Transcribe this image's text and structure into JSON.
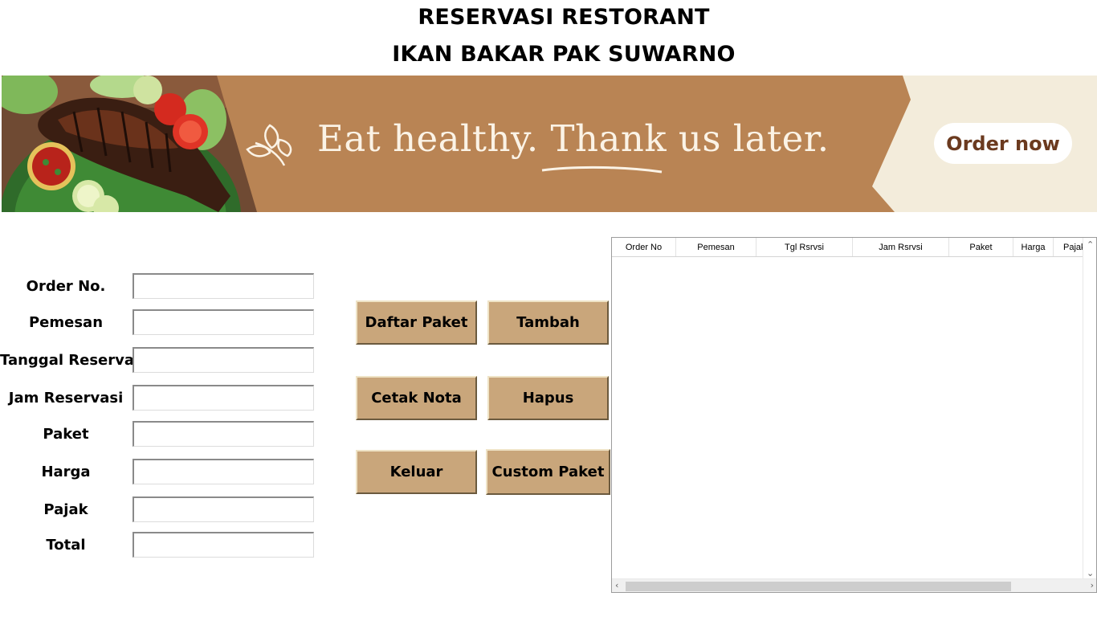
{
  "header": {
    "title_line1": "RESERVASI RESTORANT",
    "title_line2": "IKAN BAKAR PAK SUWARNO"
  },
  "banner": {
    "slogan": "Eat healthy. Thank us later.",
    "order_button": "Order now",
    "colors": {
      "ribbon": "#b98454",
      "cream": "#f3ecdb",
      "button_text": "#6b3a1f"
    },
    "icons": [
      "grilled-fish-icon",
      "leaf-sprig-icon"
    ]
  },
  "form": {
    "fields": [
      {
        "label": "Order No.",
        "value": ""
      },
      {
        "label": "Pemesan",
        "value": ""
      },
      {
        "label": "Tanggal Reservasi",
        "value": ""
      },
      {
        "label": "Jam Reservasi",
        "value": ""
      },
      {
        "label": "Paket",
        "value": ""
      },
      {
        "label": "Harga",
        "value": ""
      },
      {
        "label": "Pajak",
        "value": ""
      },
      {
        "label": "Total",
        "value": ""
      }
    ]
  },
  "buttons": {
    "daftar_paket": "Daftar Paket",
    "tambah": "Tambah",
    "cetak_nota": "Cetak Nota",
    "hapus": "Hapus",
    "keluar": "Keluar",
    "custom_paket": "Custom Paket",
    "color": "#c9a67b"
  },
  "table": {
    "columns": [
      "Order No",
      "Pemesan",
      "Tgl Rsrvsi",
      "Jam Rsrvsi",
      "Paket",
      "Harga",
      "Pajak"
    ],
    "rows": []
  }
}
